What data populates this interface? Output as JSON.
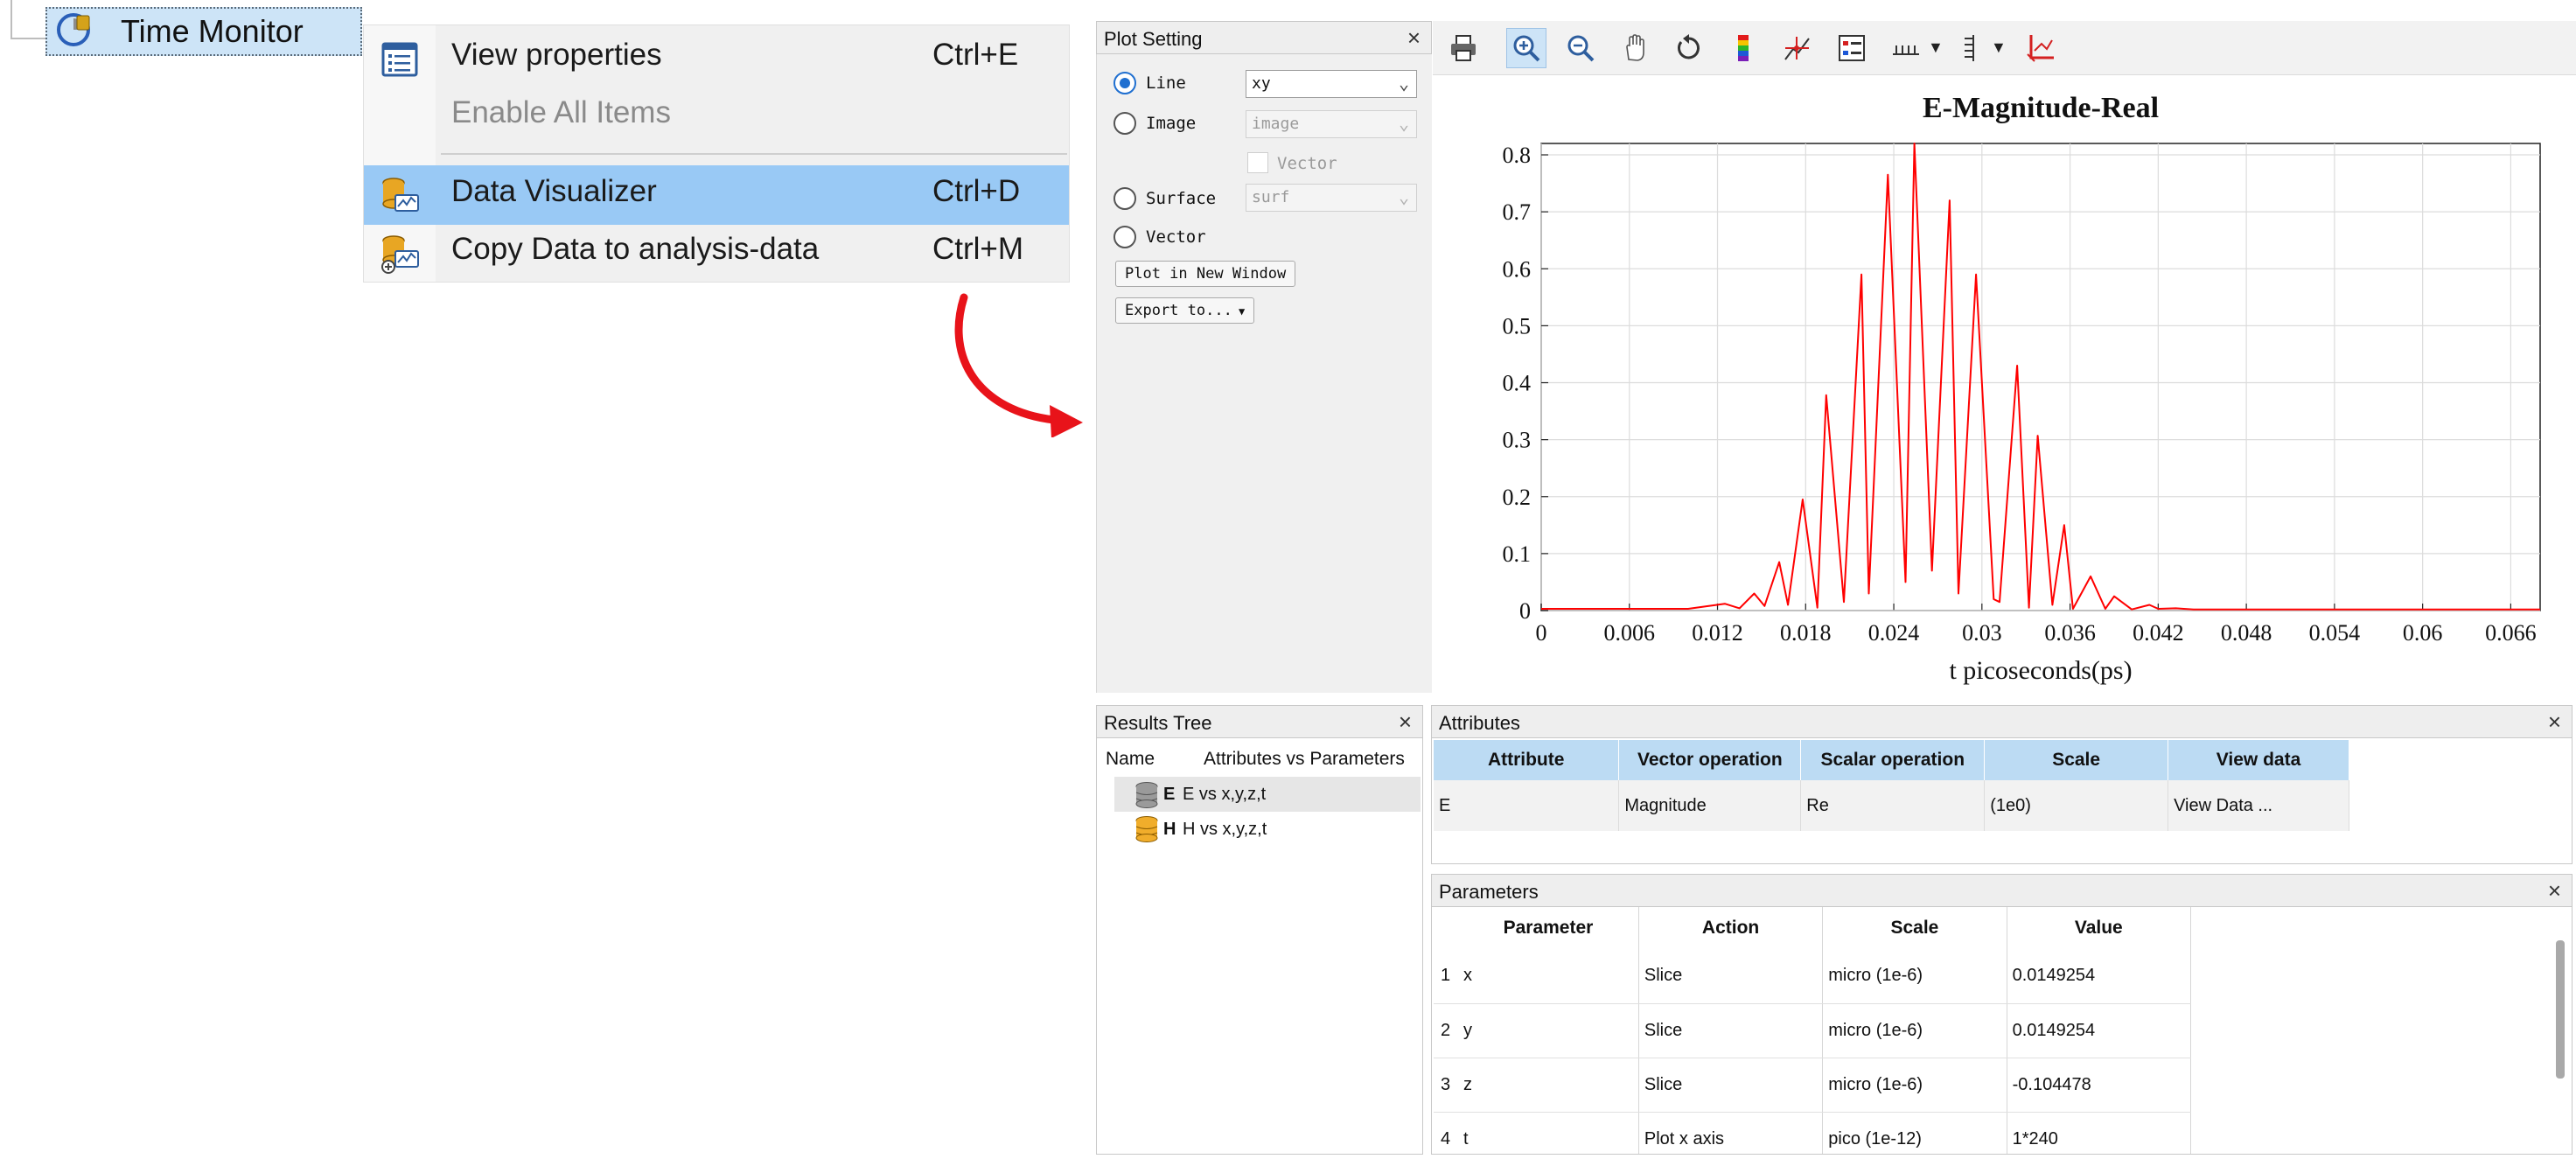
{
  "tree": {
    "item_label": "Time Monitor"
  },
  "context_menu": {
    "items": [
      {
        "label": "View properties",
        "shortcut": "Ctrl+E"
      },
      {
        "label": "Enable All Items",
        "shortcut": ""
      },
      {
        "label": "Data Visualizer",
        "shortcut": "Ctrl+D"
      },
      {
        "label": "Copy Data to analysis-data",
        "shortcut": "Ctrl+M"
      }
    ]
  },
  "annotation": {
    "arrow_color": "#e8131a"
  },
  "plot_setting": {
    "title": "Plot Setting",
    "close": "×",
    "line_label": "Line",
    "line_value": "xy",
    "image_label": "Image",
    "image_value": "image",
    "vector_check_label": "Vector",
    "surface_label": "Surface",
    "surface_value": "surf",
    "vector_label": "Vector",
    "plot_new_window": "Plot in New Window",
    "export_to": "Export to..."
  },
  "toolbar": {
    "icons": [
      "print-icon",
      "zoom-in-icon",
      "zoom-out-icon",
      "pan-icon",
      "reset-icon",
      "colormap-icon",
      "data-cursor-icon",
      "legend-icon",
      "x-axis-icon",
      "y-axis-icon",
      "axes-icon"
    ]
  },
  "chart_data": {
    "type": "line",
    "title": "E-Magnitude-Real",
    "xlabel": "t picoseconds(ps)",
    "ylabel": "",
    "xlim": [
      0,
      0.068
    ],
    "ylim": [
      0,
      0.82
    ],
    "xticks": [
      "0",
      "0.006",
      "0.012",
      "0.018",
      "0.024",
      "0.03",
      "0.036",
      "0.042",
      "0.048",
      "0.054",
      "0.06",
      "0.066"
    ],
    "yticks": [
      "0",
      "0.1",
      "0.2",
      "0.3",
      "0.4",
      "0.5",
      "0.6",
      "0.7",
      "0.8"
    ],
    "grid": true,
    "series": [
      {
        "color": "#ff0000",
        "x": [
          0,
          0.01,
          0.0125,
          0.0135,
          0.0145,
          0.0152,
          0.0162,
          0.0168,
          0.0178,
          0.0188,
          0.0194,
          0.0206,
          0.0218,
          0.0223,
          0.0236,
          0.0248,
          0.0254,
          0.0266,
          0.0278,
          0.0284,
          0.0296,
          0.0308,
          0.0312,
          0.0324,
          0.0332,
          0.0338,
          0.0348,
          0.0356,
          0.0362,
          0.0374,
          0.0384,
          0.039,
          0.0402,
          0.0414,
          0.042,
          0.0432,
          0.0444,
          0.0452,
          0.0462,
          0.0474,
          0.0482,
          0.05,
          0.068
        ],
        "y": [
          0.003,
          0.003,
          0.012,
          0.004,
          0.03,
          0.008,
          0.085,
          0.01,
          0.195,
          0.005,
          0.378,
          0.015,
          0.59,
          0.03,
          0.765,
          0.05,
          0.82,
          0.07,
          0.72,
          0.03,
          0.59,
          0.02,
          0.015,
          0.43,
          0.005,
          0.307,
          0.01,
          0.15,
          0.003,
          0.06,
          0.003,
          0.025,
          0.002,
          0.01,
          0.003,
          0.004,
          0.002,
          0.002,
          0.002,
          0.002,
          0.002,
          0.002,
          0.002
        ]
      }
    ]
  },
  "results_tree": {
    "title": "Results Tree",
    "close": "×",
    "col_name": "Name",
    "col_attrs": "Attributes vs Parameters",
    "rows": [
      {
        "name": "E",
        "desc": "E vs x,y,z,t"
      },
      {
        "name": "H",
        "desc": "H vs x,y,z,t"
      }
    ]
  },
  "attributes": {
    "title": "Attributes",
    "close": "×",
    "headers": [
      "Attribute",
      "Vector operation",
      "Scalar operation",
      "Scale",
      "View data"
    ],
    "row": [
      "E",
      "Magnitude",
      "Re",
      "(1e0)",
      "View Data ..."
    ]
  },
  "parameters": {
    "title": "Parameters",
    "close": "×",
    "headers": [
      "Parameter",
      "Action",
      "Scale",
      "Value"
    ],
    "rows": [
      {
        "idx": "1",
        "param": "x",
        "action": "Slice",
        "scale": "micro (1e-6)",
        "value": "0.0149254"
      },
      {
        "idx": "2",
        "param": "y",
        "action": "Slice",
        "scale": "micro (1e-6)",
        "value": "0.0149254"
      },
      {
        "idx": "3",
        "param": "z",
        "action": "Slice",
        "scale": "micro (1e-6)",
        "value": "-0.104478"
      },
      {
        "idx": "4",
        "param": "t",
        "action": "Plot x axis",
        "scale": "pico (1e-12)",
        "value": "1*240"
      }
    ]
  }
}
